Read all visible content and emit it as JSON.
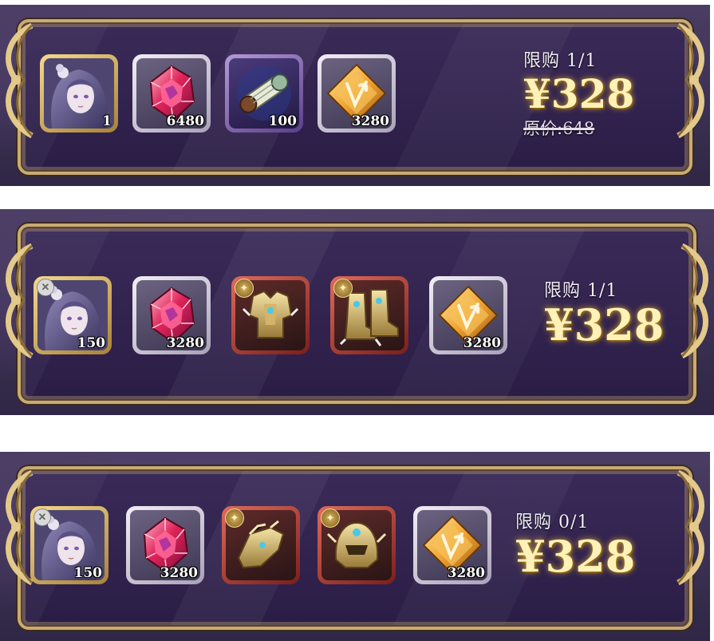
{
  "colors": {
    "frame_gold": "#c9ab72",
    "panel_purple": "#2a1d45",
    "price_gold": "#fff2b8"
  },
  "packs": [
    {
      "limit": "限购 1/1",
      "price": "¥328",
      "original_price": "原价:648",
      "items": [
        {
          "icon": "character-portrait-icon",
          "frame": "gold",
          "qty": "1"
        },
        {
          "icon": "red-gem-icon",
          "frame": "silver",
          "qty": "6480"
        },
        {
          "icon": "scroll-icon",
          "frame": "purple",
          "qty": "100"
        },
        {
          "icon": "v-crystal-icon",
          "frame": "silver",
          "qty": "3280"
        }
      ]
    },
    {
      "limit": "限购 1/1",
      "price": "¥328",
      "items": [
        {
          "icon": "character-portrait-icon",
          "frame": "gold",
          "qty": "150"
        },
        {
          "icon": "red-gem-icon",
          "frame": "silver",
          "qty": "3280"
        },
        {
          "icon": "gold-armor-icon",
          "frame": "red",
          "qty": ""
        },
        {
          "icon": "gold-boots-icon",
          "frame": "red",
          "qty": ""
        },
        {
          "icon": "v-crystal-icon",
          "frame": "silver",
          "qty": "3280"
        }
      ]
    },
    {
      "limit": "限购 0/1",
      "price": "¥328",
      "items": [
        {
          "icon": "character-portrait-icon",
          "frame": "gold",
          "qty": "150"
        },
        {
          "icon": "red-gem-icon",
          "frame": "silver",
          "qty": "3280"
        },
        {
          "icon": "gold-gauntlet-icon",
          "frame": "red",
          "qty": ""
        },
        {
          "icon": "gold-helmet-icon",
          "frame": "red",
          "qty": ""
        },
        {
          "icon": "v-crystal-icon",
          "frame": "silver",
          "qty": "3280"
        }
      ]
    }
  ]
}
